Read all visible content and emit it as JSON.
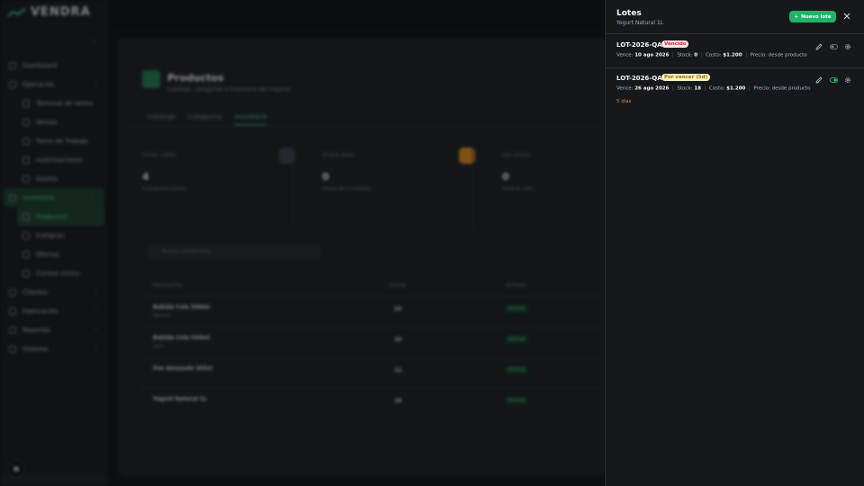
{
  "app": {
    "logo_text": "VENDRA"
  },
  "sidebar": {
    "items": [
      {
        "label": "Dashboard",
        "level": 0
      },
      {
        "label": "Operación",
        "level": 0,
        "chevron": true
      },
      {
        "label": "Terminal de Venta",
        "level": 1
      },
      {
        "label": "Ventas",
        "level": 1
      },
      {
        "label": "Turno de Trabajo",
        "level": 1
      },
      {
        "label": "Autorizaciones",
        "level": 1
      },
      {
        "label": "Gastos",
        "level": 1
      },
      {
        "label": "Inventario",
        "level": 0,
        "chevron": true,
        "active_parent": true
      },
      {
        "label": "Productos",
        "level": 1,
        "active": true
      },
      {
        "label": "Compras",
        "level": 1
      },
      {
        "label": "Ofertas",
        "level": 1
      },
      {
        "label": "Conteo cíclico",
        "level": 1
      },
      {
        "label": "Clientes",
        "level": 0,
        "chevron": true
      },
      {
        "label": "Fabricación",
        "level": 0,
        "chevron": true
      },
      {
        "label": "Reportes",
        "level": 0,
        "chevron": true
      },
      {
        "label": "Sistema",
        "level": 0,
        "chevron": true
      }
    ],
    "user_initial": "N"
  },
  "page": {
    "title": "Productos",
    "subtitle": "Catálogo, categorías e inventario del negocio.",
    "tabs": [
      "Catálogo",
      "Categorías",
      "Inventario"
    ],
    "active_tab": "Inventario",
    "stats": [
      {
        "label": "TOTAL ITEMS",
        "value": "4",
        "note": "4 productos activos",
        "badge_color": "#3a4046"
      },
      {
        "label": "STOCK BAJO",
        "value": "0",
        "note": "menos de 5 unidades",
        "badge_color": "#e08a1a"
      },
      {
        "label": "SIN STOCK",
        "value": "0",
        "note": "stock en cero",
        "badge_color": ""
      }
    ],
    "search_placeholder": "Buscar productos...",
    "table": {
      "headers": [
        "PRODUCTO",
        "STOCK",
        "ESTADO"
      ],
      "rows": [
        {
          "name": "Bebida Cola 500ml",
          "category": "Normal",
          "stock": "24",
          "status": "Normal"
        },
        {
          "name": "Bebida Cola 500ml",
          "category": "Zero",
          "stock": "20",
          "status": "Normal"
        },
        {
          "name": "Pan Amasado (Kilo)",
          "category": "",
          "stock": "12",
          "status": "Normal"
        },
        {
          "name": "Yogurt Natural 1L",
          "category": "",
          "stock": "18",
          "status": "Normal"
        }
      ]
    }
  },
  "drawer": {
    "title": "Lotes",
    "subtitle": "Yogurt Natural 1L",
    "new_button": "Nuevo lote",
    "lots": [
      {
        "code": "LOT-2026-QA1",
        "status": "Vencido",
        "status_kind": "expired",
        "vence_label": "Vence:",
        "vence": "10 ago 2026",
        "stock_label": "Stock:",
        "stock": "0",
        "costo_label": "Costo:",
        "costo": "$1.200",
        "precio": "Precio: desde producto",
        "toggle_on": false
      },
      {
        "code": "LOT-2026-QA2",
        "status": "Por vencer (5d)",
        "status_kind": "soon",
        "vence_label": "Vence:",
        "vence": "26 ago 2026",
        "stock_label": "Stock:",
        "stock": "18",
        "costo_label": "Costo:",
        "costo": "$1.200",
        "precio": "Precio: desde producto",
        "toggle_on": true,
        "days_left": "5 días"
      }
    ]
  },
  "colors": {
    "accent": "#20b368",
    "expired": "#d22a2a",
    "soon": "#9a6a00",
    "warning_text": "#e0862b"
  }
}
